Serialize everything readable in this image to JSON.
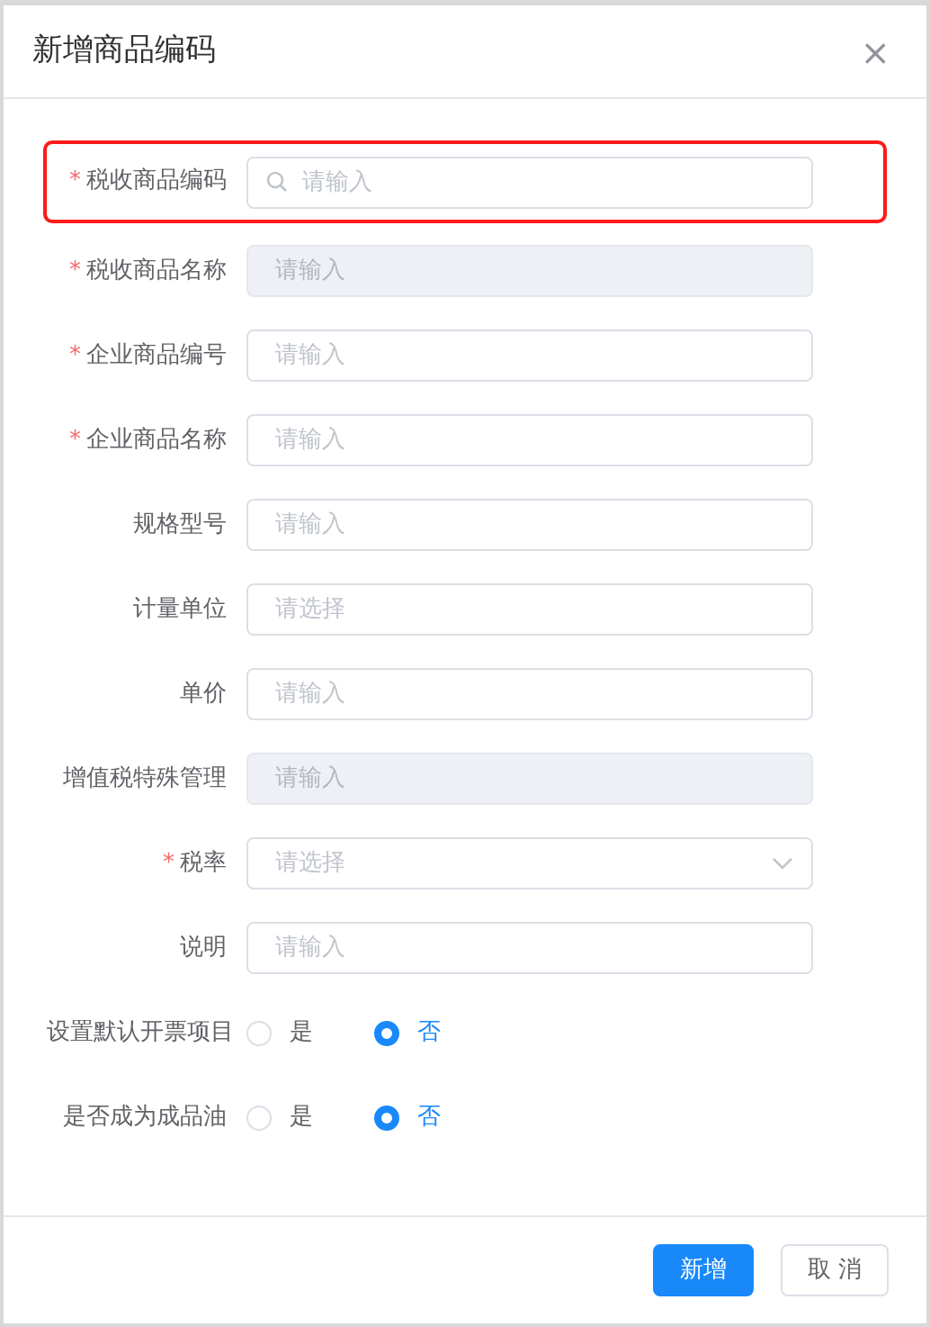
{
  "dialog": {
    "title": "新增商品编码",
    "close": "×"
  },
  "fields": [
    {
      "label": "税收商品编码",
      "required_mark": "*",
      "kind": "search",
      "placeholder": "请输入",
      "disabled": false,
      "highlighted": true
    },
    {
      "label": "税收商品名称",
      "required_mark": "*",
      "kind": "input",
      "placeholder": "请输入",
      "disabled": true,
      "highlighted": false
    },
    {
      "label": "企业商品编号",
      "required_mark": "*",
      "kind": "input",
      "placeholder": "请输入",
      "disabled": false,
      "highlighted": false
    },
    {
      "label": "企业商品名称",
      "required_mark": "*",
      "kind": "input",
      "placeholder": "请输入",
      "disabled": false,
      "highlighted": false
    },
    {
      "label": "规格型号",
      "kind": "input",
      "placeholder": "请输入",
      "disabled": false,
      "highlighted": false
    },
    {
      "label": "计量单位",
      "kind": "input",
      "placeholder": "请选择",
      "disabled": false,
      "highlighted": false
    },
    {
      "label": "单价",
      "kind": "input",
      "placeholder": "请输入",
      "disabled": false,
      "highlighted": false
    },
    {
      "label": "增值税特殊管理",
      "kind": "input",
      "placeholder": "请输入",
      "disabled": true,
      "highlighted": false
    },
    {
      "label": "税率",
      "required_mark": "*",
      "kind": "select",
      "placeholder": "请选择",
      "disabled": false,
      "highlighted": false
    },
    {
      "label": "说明",
      "kind": "input",
      "placeholder": "请输入",
      "disabled": false,
      "highlighted": false
    }
  ],
  "radio_groups": [
    {
      "label": "设置默认开票项目",
      "options": [
        {
          "label": "是",
          "selected": false
        },
        {
          "label": "否",
          "selected": true
        }
      ]
    },
    {
      "label": "是否成为成品油",
      "options": [
        {
          "label": "是",
          "selected": false
        },
        {
          "label": "否",
          "selected": true
        }
      ]
    }
  ],
  "buttons": [
    {
      "label": "新增",
      "kind": "primary"
    },
    {
      "label": "取 消",
      "kind": "default"
    }
  ]
}
